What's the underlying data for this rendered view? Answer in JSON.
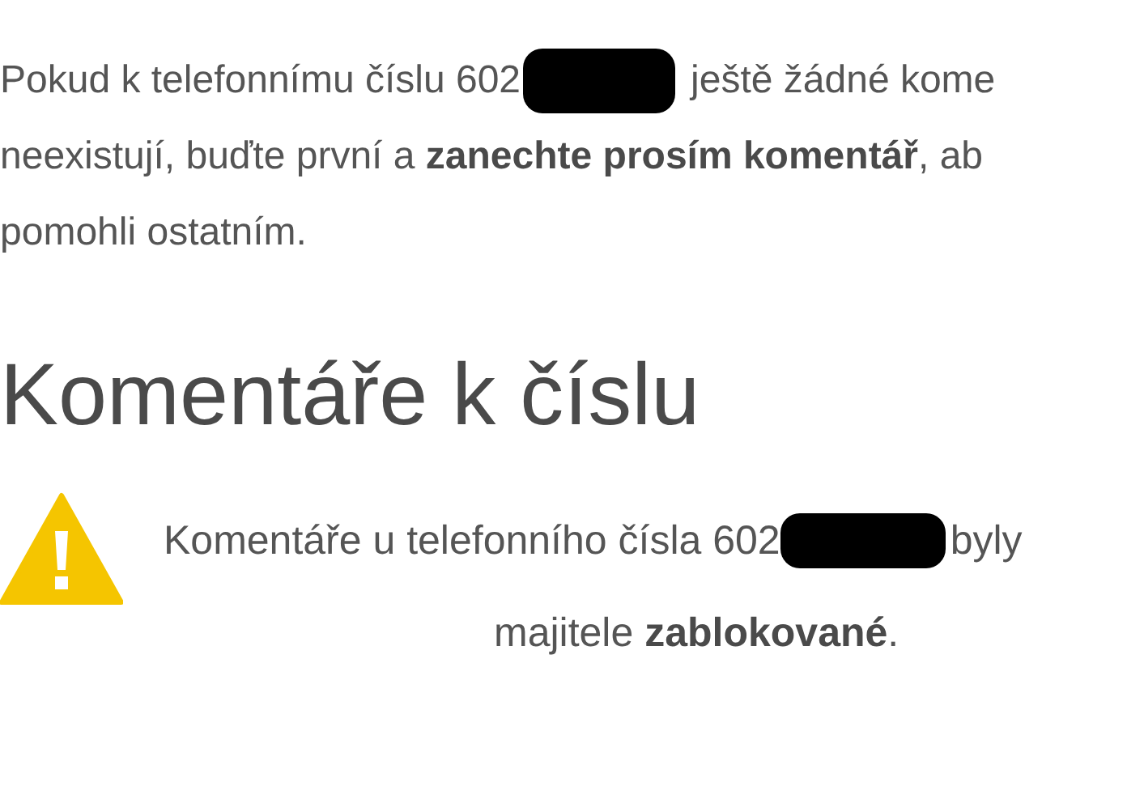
{
  "intro": {
    "lines": [
      {
        "before": "Pokud k telefonnímu číslu 602",
        "redacted": true,
        "after": "ještě žádné kome"
      },
      {
        "before": "neexistují, buďte první a **zanechte prosím komentář**, ab",
        "redacted": false
      },
      {
        "before": "pomohli ostatním.",
        "redacted": false
      }
    ]
  },
  "heading": "Komentáře k číslu",
  "notice": {
    "lines": [
      {
        "before": "Komentáře u telefonního čísla 602",
        "redacted": true,
        "after": "byly"
      },
      {
        "before": "majitele **zablokované**.",
        "redacted": false
      }
    ]
  }
}
